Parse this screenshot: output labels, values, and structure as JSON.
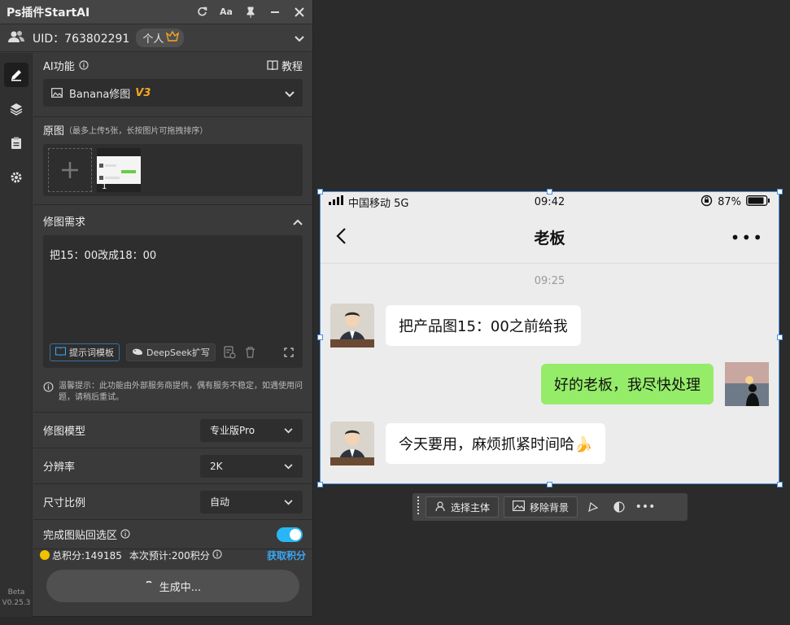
{
  "app": {
    "title": "Ps插件StartAI"
  },
  "user": {
    "uid_label": "UID：763802291",
    "plan": "个人"
  },
  "ai": {
    "section_label": "AI功能",
    "tutorial": "教程",
    "model_name": "Banana修图",
    "model_version": "V3"
  },
  "upload": {
    "label": "原图",
    "hint": "（最多上传5张，长按图片可拖拽排序）",
    "count": "1"
  },
  "request": {
    "label": "修图需求",
    "text": "把15：00改成18：00",
    "template_btn": "提示词模板",
    "deepseek_btn": "DeepSeek扩写"
  },
  "notice": {
    "text": "温馨提示：此功能由外部服务商提供，偶有服务不稳定，如遇使用问题，请稍后重试。"
  },
  "settings": [
    {
      "label": "修图模型",
      "value": "专业版Pro"
    },
    {
      "label": "分辨率",
      "value": "2K"
    },
    {
      "label": "尺寸比例",
      "value": "自动"
    }
  ],
  "paste_back": {
    "label": "完成图贴回选区",
    "enabled": true
  },
  "footer": {
    "total": "总积分:149185",
    "estimate": "本次预计:200积分",
    "get_points": "获取积分",
    "generate": "生成中..."
  },
  "version": {
    "line1": "Beta",
    "line2": "V0.25.3"
  },
  "phone": {
    "carrier": "中国移动  5G",
    "time": "09:42",
    "battery": "87%",
    "contact": "老板",
    "stamp": "09:25",
    "messages": [
      {
        "side": "left",
        "text": "把产品图15：00之前给我"
      },
      {
        "side": "right",
        "text": "好的老板，我尽快处理"
      },
      {
        "side": "left",
        "text": "今天要用，麻烦抓紧时间哈🍌"
      }
    ]
  },
  "floatbar": {
    "select_subject": "选择主体",
    "remove_bg": "移除背景"
  },
  "colors": {
    "accent": "#29b6f6",
    "link": "#39a9f5",
    "version_tag": "#f5a623",
    "bubble_green": "#95ec69"
  }
}
